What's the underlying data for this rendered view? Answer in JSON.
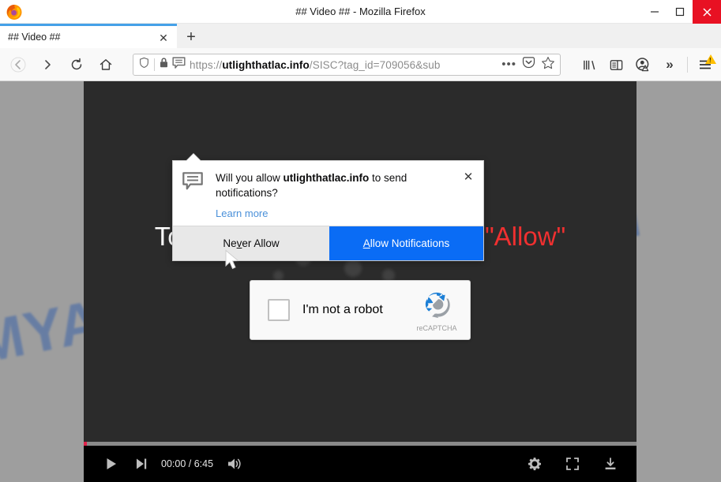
{
  "window": {
    "title": "## Video ## - Mozilla Firefox",
    "minimize_label": "—",
    "maximize_label": "□",
    "close_label": "✕"
  },
  "tabs": {
    "active_tab_title": "## Video ##",
    "close_label": "✕",
    "new_tab_label": "+"
  },
  "nav": {
    "back_label": "←",
    "forward_label": "→",
    "reload_label": "↻",
    "home_label": "⌂"
  },
  "urlbar": {
    "scheme": "https://",
    "host": "utlighthatlac.info",
    "path": "/SISC?tag_id=709056&sub",
    "full_url": "https://utlighthatlac.info/SISC?tag_id=709056&sub",
    "shield_icon": "shield-icon",
    "lock_icon": "padlock-icon",
    "permission_icon": "notification-bubble-icon",
    "overflow_label": "•••",
    "pocket_icon": "pocket-icon",
    "bookmark_icon": "star-icon"
  },
  "toolbar_right": {
    "library_icon": "library-icon",
    "sidebar_icon": "sidebar-icon",
    "account_icon": "account-warning-icon",
    "overflow_label": "»",
    "menu_icon": "hamburger-menu-icon"
  },
  "notification": {
    "question_prefix": "Will you allow ",
    "domain": "utlighthatlac.info",
    "question_suffix": " to send notifications?",
    "learn_more": "Learn more",
    "close_label": "✕",
    "never_allow": "Never Allow",
    "never_allow_accesskey": "v",
    "allow": "Allow Notifications",
    "allow_accesskey": "A",
    "allow_button_color": "#0a6cf5",
    "icon": "notification-bubble-icon"
  },
  "page": {
    "background_color": "#9e9e9e",
    "video_background_color": "#2b2b2b",
    "watermark": "MYANTISPYWARE.COM",
    "watermark_color": "#3b63a8",
    "headline_prefix": "To access to the video, click ",
    "headline_highlight": "\"Allow\"",
    "headline_highlight_color": "#f03030"
  },
  "recaptcha": {
    "checkbox_label": "I'm not a robot",
    "brand": "reCAPTCHA",
    "logo_blue": "#1c7fd6",
    "logo_gray": "#9aa0a6",
    "checkbox_icon": "recaptcha-checkbox-icon"
  },
  "player": {
    "play_icon": "play-icon",
    "next_icon": "next-track-icon",
    "time": "00:00 / 6:45",
    "current_time": "00:00",
    "duration": "6:45",
    "volume_icon": "volume-icon",
    "settings_icon": "gear-icon",
    "fullscreen_icon": "fullscreen-icon",
    "download_icon": "download-icon",
    "progress_color": "#e0224a",
    "progress_percent": 0
  },
  "cursor": {
    "icon": "mouse-pointer-icon"
  }
}
